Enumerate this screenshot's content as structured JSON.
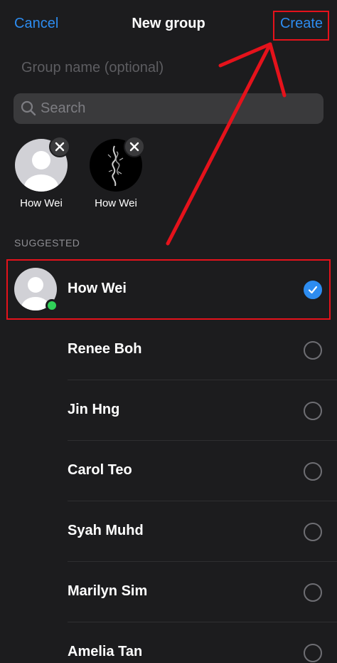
{
  "header": {
    "cancel_label": "Cancel",
    "title": "New group",
    "create_label": "Create"
  },
  "group_name": {
    "value": "",
    "placeholder": "Group name (optional)"
  },
  "search": {
    "value": "",
    "placeholder": "Search"
  },
  "selected": [
    {
      "name": "How Wei",
      "avatar": "default-avatar"
    },
    {
      "name": "How Wei",
      "avatar": "dragon-artwork-avatar"
    }
  ],
  "section_label": "SUGGESTED",
  "contacts": [
    {
      "name": "How Wei",
      "checked": true,
      "online": true,
      "avatar": "default-avatar"
    },
    {
      "name": "Renee Boh",
      "checked": false
    },
    {
      "name": "Jin Hng",
      "checked": false
    },
    {
      "name": "Carol Teo",
      "checked": false
    },
    {
      "name": "Syah Muhd",
      "checked": false
    },
    {
      "name": "Marilyn Sim",
      "checked": false
    },
    {
      "name": "Amelia Tan",
      "checked": false
    }
  ],
  "colors": {
    "background": "#1c1c1e",
    "accent": "#2d8cf0",
    "annotation": "#e5121b",
    "online": "#30d158"
  }
}
